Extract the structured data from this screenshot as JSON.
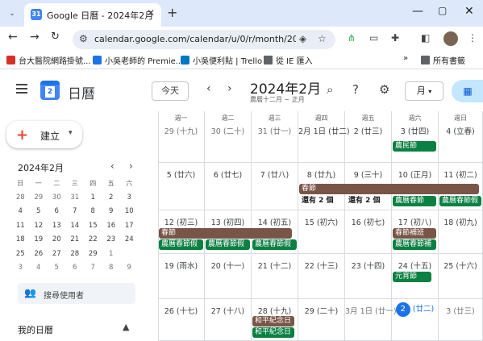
{
  "browser": {
    "tab_title": "Google 日曆 - 2024年2月",
    "tab_favicon": "31",
    "url": "calendar.google.com/calendar/u/0/r/month/2024...",
    "bookmarks": [
      {
        "label": "台大醫院網路掛號...",
        "color": "#d93025"
      },
      {
        "label": "小吳老師的 Premie...",
        "color": "#1a73e8"
      },
      {
        "label": "小吳便利貼 | Trello",
        "color": "#0079bf"
      },
      {
        "label": "從 IE 匯入",
        "color": "#5f6368"
      }
    ],
    "all_bookmarks": "所有書籤"
  },
  "header": {
    "app_name": "日曆",
    "logo_number": "2",
    "today_button": "今天",
    "month_title": "2024年2月",
    "lunar_title": "農曆十二月 ~ 正月",
    "view_select": "月",
    "view_select_caret": "▾"
  },
  "sidebar": {
    "create_label": "建立",
    "mini_title": "2024年2月",
    "mini_headers": [
      "日",
      "一",
      "二",
      "三",
      "四",
      "五",
      "六"
    ],
    "mini_weeks": [
      [
        "28",
        "29",
        "30",
        "31",
        "1",
        "2",
        "3"
      ],
      [
        "4",
        "5",
        "6",
        "7",
        "8",
        "9",
        "10"
      ],
      [
        "11",
        "12",
        "13",
        "14",
        "15",
        "16",
        "17"
      ],
      [
        "18",
        "19",
        "20",
        "21",
        "22",
        "23",
        "24"
      ],
      [
        "25",
        "26",
        "27",
        "28",
        "29",
        "1",
        "2"
      ],
      [
        "3",
        "4",
        "5",
        "6",
        "7",
        "8",
        "9"
      ]
    ],
    "search_people": "搜尋使用者",
    "my_calendars": "我的日曆"
  },
  "month": {
    "weekdays": [
      "週一",
      "週二",
      "週三",
      "週四",
      "週五",
      "週六",
      "週日"
    ],
    "weeks": [
      [
        "29 (十九)",
        "30 (二十)",
        "31 (廿一)",
        "2月 1日 (廿二)",
        "2 (廿三)",
        "3 (廿四)",
        "4 (立春)"
      ],
      [
        "5 (廿六)",
        "6 (廿七)",
        "7 (廿八)",
        "8 (廿九)",
        "9 (三十)",
        "10 (正月)",
        "11 (初二)"
      ],
      [
        "12 (初三)",
        "13 (初四)",
        "14 (初五)",
        "15 (初六)",
        "16 (初七)",
        "17 (初八)",
        "18 (初九)"
      ],
      [
        "19 (雨水)",
        "20 (十一)",
        "21 (十二)",
        "22 (十三)",
        "23 (十四)",
        "24 (十五)",
        "25 (十六)"
      ],
      [
        "26 (十七)",
        "27 (十八)",
        "28 (十九)",
        "29 (二十)",
        "3月 1日 (廿一)",
        "2",
        "3 (廿三)"
      ]
    ],
    "today_extra": "(廿二)",
    "events": {
      "w1_sun": "農民節",
      "w2_span": "春節",
      "w2_more1": "還有 2 個",
      "w2_more2": "還有 2 個",
      "w2_sat": "農曆春節",
      "w2_sun": "農曆春節假",
      "w3_span": "春節",
      "w3_mon": "農曆春節假",
      "w3_tue": "農曆春節假",
      "w3_wed": "農曆春節假",
      "w3_sat1": "春節補班",
      "w3_sat2": "農曆春節補",
      "w4_sat": "元宵節",
      "w5_wed1": "和平紀念日",
      "w5_wed2": "和平紀念日"
    }
  },
  "colors": {
    "holiday_green": "#0b8043",
    "span_brown": "#795548",
    "accent_blue": "#1a73e8"
  }
}
